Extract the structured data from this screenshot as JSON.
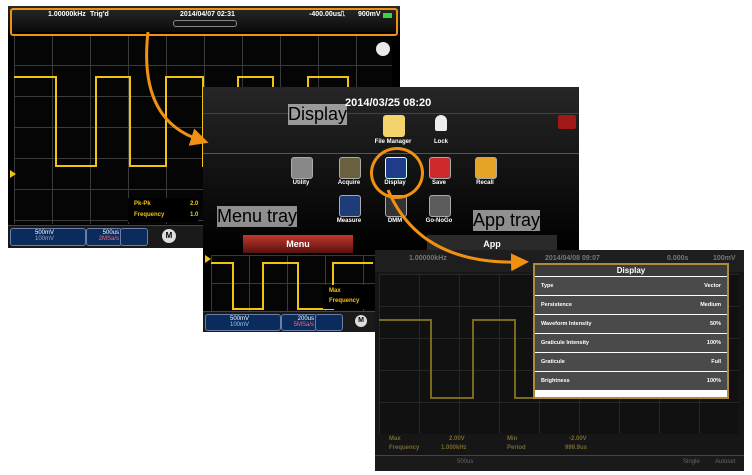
{
  "screen1": {
    "top_bar": {
      "frequency": "1.00000kHz",
      "trigger_state": "Trig'd",
      "datetime": "2014/04/07 02:31",
      "timebase_pos": "-400.00us",
      "trigger_level": "900mV"
    },
    "measurements": [
      {
        "label": "Pk-Pk",
        "value": "2.0"
      },
      {
        "label": "Frequency",
        "value": "1.0"
      }
    ],
    "bottom_bar": {
      "ch1_scale": "500mV",
      "ch2_scale": "100mV",
      "timebase": "500us",
      "sample_rate": "2MSa/s"
    }
  },
  "screen2": {
    "datetime": "2014/03/25   08:20",
    "menu_items": [
      {
        "label": "File Manager",
        "icon": "folder-icon"
      },
      {
        "label": "Lock",
        "icon": "lock-icon"
      },
      {
        "label": "Utility",
        "icon": "gear-icon"
      },
      {
        "label": "Acquire",
        "icon": "acquire-icon"
      },
      {
        "label": "Display",
        "icon": "display-icon"
      },
      {
        "label": "Save",
        "icon": "save-icon"
      },
      {
        "label": "Recall",
        "icon": "recall-icon"
      },
      {
        "label": "Measure",
        "icon": "measure-icon"
      },
      {
        "label": "DMM",
        "icon": "dmm-icon"
      },
      {
        "label": "Go-NoGo",
        "icon": "go-nogo-icon"
      }
    ],
    "tabs": {
      "menu": "Menu",
      "app": "App"
    },
    "measurements": [
      {
        "label": "Max"
      },
      {
        "label": "Frequency"
      }
    ],
    "bottom_bar": {
      "ch1_scale": "500mV",
      "ch2_scale": "100mV",
      "timebase": "200us",
      "sample_rate": "5MSa/s",
      "save_label": "Save"
    }
  },
  "screen3": {
    "top_bar": {
      "frequency": "1.00000kHz",
      "datetime": "2014/04/08 09:07",
      "timebase_pos": "0.000s",
      "trigger_level": "100mV"
    },
    "display_dialog": {
      "title": "Display",
      "rows": [
        {
          "label": "Type",
          "value": "Vector"
        },
        {
          "label": "Persistence",
          "value": "Medium"
        },
        {
          "label": "Waveform Intensity",
          "value": "50%"
        },
        {
          "label": "Graticule Intensity",
          "value": "100%"
        },
        {
          "label": "Graticule",
          "value": "Full"
        },
        {
          "label": "Brightness",
          "value": "100%"
        }
      ]
    },
    "measurements": [
      {
        "label": "Max",
        "value": "2.00V",
        "label2": "Min",
        "value2": "-2.00V"
      },
      {
        "label": "Frequency",
        "value": "1.000kHz",
        "label2": "Period",
        "value2": "999.9us"
      }
    ],
    "bottom_bar": {
      "timebase": "500us",
      "single": "Single",
      "auto": "Autoset"
    }
  },
  "annotations": {
    "display": "Display",
    "menu_tray": "Menu tray",
    "app_tray": "App tray"
  },
  "colors": {
    "highlight": "#f29111",
    "waveform": "#f1c40f",
    "accent_red": "#a01818"
  }
}
